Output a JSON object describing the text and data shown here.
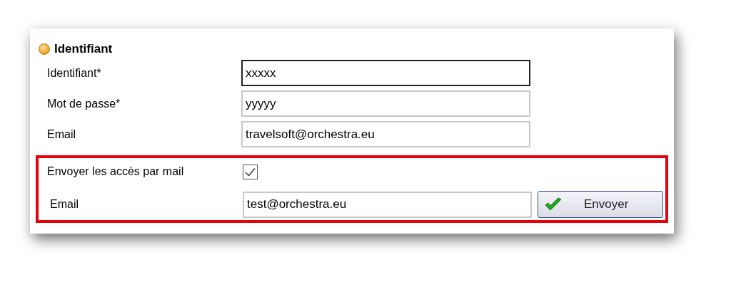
{
  "section": {
    "title": "Identifiant"
  },
  "fields": [
    {
      "label": "Identifiant*",
      "value": "xxxxx",
      "focused": true
    },
    {
      "label": "Mot de passe*",
      "value": "yyyyy",
      "focused": false
    },
    {
      "label": "Email",
      "value": "travelsoft@orchestra.eu",
      "focused": false
    }
  ],
  "send_access": {
    "label": "Envoyer les accès par mail",
    "checked": true,
    "email_label": "Email",
    "email_value": "test@orchestra.eu",
    "button": "Envoyer"
  }
}
